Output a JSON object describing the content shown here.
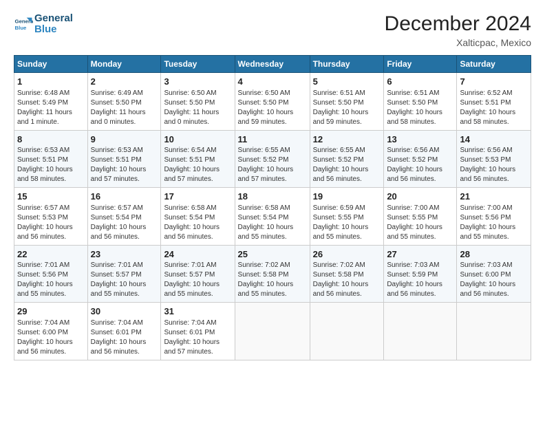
{
  "logo": {
    "line1": "General",
    "line2": "Blue"
  },
  "title": "December 2024",
  "subtitle": "Xalticpac, Mexico",
  "days_of_week": [
    "Sunday",
    "Monday",
    "Tuesday",
    "Wednesday",
    "Thursday",
    "Friday",
    "Saturday"
  ],
  "weeks": [
    [
      {
        "day": "1",
        "info": "Sunrise: 6:48 AM\nSunset: 5:49 PM\nDaylight: 11 hours\nand 1 minute."
      },
      {
        "day": "2",
        "info": "Sunrise: 6:49 AM\nSunset: 5:50 PM\nDaylight: 11 hours\nand 0 minutes."
      },
      {
        "day": "3",
        "info": "Sunrise: 6:50 AM\nSunset: 5:50 PM\nDaylight: 11 hours\nand 0 minutes."
      },
      {
        "day": "4",
        "info": "Sunrise: 6:50 AM\nSunset: 5:50 PM\nDaylight: 10 hours\nand 59 minutes."
      },
      {
        "day": "5",
        "info": "Sunrise: 6:51 AM\nSunset: 5:50 PM\nDaylight: 10 hours\nand 59 minutes."
      },
      {
        "day": "6",
        "info": "Sunrise: 6:51 AM\nSunset: 5:50 PM\nDaylight: 10 hours\nand 58 minutes."
      },
      {
        "day": "7",
        "info": "Sunrise: 6:52 AM\nSunset: 5:51 PM\nDaylight: 10 hours\nand 58 minutes."
      }
    ],
    [
      {
        "day": "8",
        "info": "Sunrise: 6:53 AM\nSunset: 5:51 PM\nDaylight: 10 hours\nand 58 minutes."
      },
      {
        "day": "9",
        "info": "Sunrise: 6:53 AM\nSunset: 5:51 PM\nDaylight: 10 hours\nand 57 minutes."
      },
      {
        "day": "10",
        "info": "Sunrise: 6:54 AM\nSunset: 5:51 PM\nDaylight: 10 hours\nand 57 minutes."
      },
      {
        "day": "11",
        "info": "Sunrise: 6:55 AM\nSunset: 5:52 PM\nDaylight: 10 hours\nand 57 minutes."
      },
      {
        "day": "12",
        "info": "Sunrise: 6:55 AM\nSunset: 5:52 PM\nDaylight: 10 hours\nand 56 minutes."
      },
      {
        "day": "13",
        "info": "Sunrise: 6:56 AM\nSunset: 5:52 PM\nDaylight: 10 hours\nand 56 minutes."
      },
      {
        "day": "14",
        "info": "Sunrise: 6:56 AM\nSunset: 5:53 PM\nDaylight: 10 hours\nand 56 minutes."
      }
    ],
    [
      {
        "day": "15",
        "info": "Sunrise: 6:57 AM\nSunset: 5:53 PM\nDaylight: 10 hours\nand 56 minutes."
      },
      {
        "day": "16",
        "info": "Sunrise: 6:57 AM\nSunset: 5:54 PM\nDaylight: 10 hours\nand 56 minutes."
      },
      {
        "day": "17",
        "info": "Sunrise: 6:58 AM\nSunset: 5:54 PM\nDaylight: 10 hours\nand 56 minutes."
      },
      {
        "day": "18",
        "info": "Sunrise: 6:58 AM\nSunset: 5:54 PM\nDaylight: 10 hours\nand 55 minutes."
      },
      {
        "day": "19",
        "info": "Sunrise: 6:59 AM\nSunset: 5:55 PM\nDaylight: 10 hours\nand 55 minutes."
      },
      {
        "day": "20",
        "info": "Sunrise: 7:00 AM\nSunset: 5:55 PM\nDaylight: 10 hours\nand 55 minutes."
      },
      {
        "day": "21",
        "info": "Sunrise: 7:00 AM\nSunset: 5:56 PM\nDaylight: 10 hours\nand 55 minutes."
      }
    ],
    [
      {
        "day": "22",
        "info": "Sunrise: 7:01 AM\nSunset: 5:56 PM\nDaylight: 10 hours\nand 55 minutes."
      },
      {
        "day": "23",
        "info": "Sunrise: 7:01 AM\nSunset: 5:57 PM\nDaylight: 10 hours\nand 55 minutes."
      },
      {
        "day": "24",
        "info": "Sunrise: 7:01 AM\nSunset: 5:57 PM\nDaylight: 10 hours\nand 55 minutes."
      },
      {
        "day": "25",
        "info": "Sunrise: 7:02 AM\nSunset: 5:58 PM\nDaylight: 10 hours\nand 55 minutes."
      },
      {
        "day": "26",
        "info": "Sunrise: 7:02 AM\nSunset: 5:58 PM\nDaylight: 10 hours\nand 56 minutes."
      },
      {
        "day": "27",
        "info": "Sunrise: 7:03 AM\nSunset: 5:59 PM\nDaylight: 10 hours\nand 56 minutes."
      },
      {
        "day": "28",
        "info": "Sunrise: 7:03 AM\nSunset: 6:00 PM\nDaylight: 10 hours\nand 56 minutes."
      }
    ],
    [
      {
        "day": "29",
        "info": "Sunrise: 7:04 AM\nSunset: 6:00 PM\nDaylight: 10 hours\nand 56 minutes."
      },
      {
        "day": "30",
        "info": "Sunrise: 7:04 AM\nSunset: 6:01 PM\nDaylight: 10 hours\nand 56 minutes."
      },
      {
        "day": "31",
        "info": "Sunrise: 7:04 AM\nSunset: 6:01 PM\nDaylight: 10 hours\nand 57 minutes."
      },
      {
        "day": "",
        "info": ""
      },
      {
        "day": "",
        "info": ""
      },
      {
        "day": "",
        "info": ""
      },
      {
        "day": "",
        "info": ""
      }
    ]
  ]
}
